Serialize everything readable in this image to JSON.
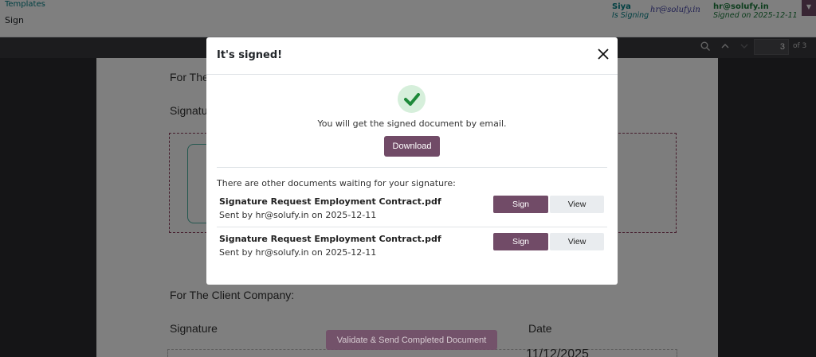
{
  "header": {
    "breadcrumb_parent": "Templates",
    "breadcrumb_current": "Sign",
    "signers": [
      {
        "name": "Siya",
        "status": "Is Signing",
        "signature": "hr@solufy.in"
      },
      {
        "name": "hr@solufy.in",
        "status": "Signed on 2025-12-11"
      }
    ]
  },
  "pdf_toolbar": {
    "page_current": "3",
    "page_total": "of 3"
  },
  "pdf": {
    "for_the": "For The",
    "signature_partial": "Signatu",
    "client_company": "For The Client Company:",
    "signature_label": "Signature",
    "date_label": "Date",
    "date_value": "11/12/2025"
  },
  "validate_button": "Validate & Send Completed Document",
  "modal": {
    "title": "It's signed!",
    "success_message": "You will get the signed document by email.",
    "download_label": "Download",
    "other_docs_title": "There are other documents waiting for your signature:",
    "documents": [
      {
        "name": "Signature Request Employment Contract.pdf",
        "meta": "Sent by hr@solufy.in on 2025-12-11",
        "sign_label": "Sign",
        "view_label": "View"
      },
      {
        "name": "Signature Request Employment Contract.pdf",
        "meta": "Sent by hr@solufy.in on 2025-12-11",
        "sign_label": "Sign",
        "view_label": "View"
      }
    ]
  },
  "colors": {
    "primary": "#714b67",
    "success": "#1e8a3a",
    "teal": "#017e84"
  }
}
